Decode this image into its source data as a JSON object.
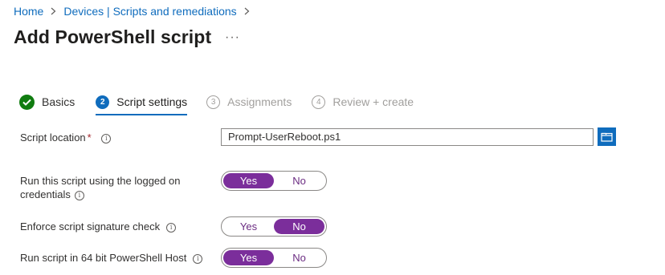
{
  "breadcrumb": {
    "home": "Home",
    "section": "Devices | Scripts and remediations"
  },
  "page": {
    "title": "Add PowerShell script",
    "more": "···"
  },
  "steps": [
    {
      "number": "✓",
      "label": "Basics",
      "state": "complete"
    },
    {
      "number": "2",
      "label": "Script settings",
      "state": "active"
    },
    {
      "number": "3",
      "label": "Assignments",
      "state": "pending"
    },
    {
      "number": "4",
      "label": "Review + create",
      "state": "pending"
    }
  ],
  "form": {
    "script_location": {
      "label": "Script location",
      "required_marker": "*",
      "value": "Prompt-UserReboot.ps1"
    },
    "run_as_logged_on": {
      "label_line1": "Run this script using the logged on",
      "label_line2": "credentials",
      "yes": "Yes",
      "no": "No",
      "selected": "Yes"
    },
    "signature_check": {
      "label": "Enforce script signature check",
      "yes": "Yes",
      "no": "No",
      "selected": "No"
    },
    "run_64bit": {
      "label": "Run script in 64 bit PowerShell Host",
      "yes": "Yes",
      "no": "No",
      "selected": "Yes"
    }
  },
  "colors": {
    "link": "#0f6cbd",
    "toggle_selected": "#7b2e9b",
    "step_complete": "#107c10",
    "required": "#a4262c"
  },
  "info_glyph": "i"
}
